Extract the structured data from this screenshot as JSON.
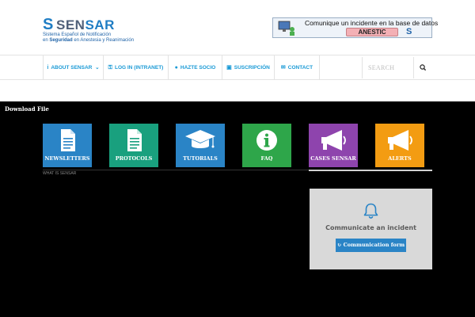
{
  "header": {
    "logo": {
      "mark": "S",
      "name_a": "SEN",
      "name_b": "SAR",
      "sub_line1": "Sistema Español de Notificación",
      "sub_line2_a": "en ",
      "sub_line2_b": "Seguridad",
      "sub_line2_c": " en Anestesia y Reanimación"
    },
    "banner": {
      "line1": "Comunique un incidente en la base de datos",
      "button": "ANESTIC",
      "mark": "S"
    }
  },
  "nav": {
    "items": [
      {
        "label": "ABOUT SENSAR",
        "icon": "info-icon",
        "icon_glyph": "i",
        "has_caret": true
      },
      {
        "label": "LOG IN (INTRANET)",
        "icon": "key-icon",
        "icon_glyph": "⚿"
      },
      {
        "label": "HAZTE SOCIO",
        "icon": "user-icon",
        "icon_glyph": "●"
      },
      {
        "label": "SUSCRIPCIÓN",
        "icon": "square-icon",
        "icon_glyph": "▣"
      },
      {
        "label": "CONTACT",
        "icon": "mail-icon",
        "icon_glyph": "✉"
      }
    ],
    "caret": "⌄",
    "search_placeholder": "SEARCH"
  },
  "main": {
    "download_label": "Download File",
    "tiles": [
      {
        "label": "NEWSLETTERS",
        "icon": "document-icon",
        "color": "#2a84c6"
      },
      {
        "label": "PROTOCOLS",
        "icon": "document-icon",
        "color": "#19a07e"
      },
      {
        "label": "TUTORIALS",
        "icon": "graduation-cap-icon",
        "color": "#2a84c6"
      },
      {
        "label": "FAQ",
        "icon": "info-circle-icon",
        "color": "#2ea64a"
      },
      {
        "label": "CASES SENSAR",
        "icon": "megaphone-icon",
        "color": "#8e44ad"
      },
      {
        "label": "ALERTS",
        "icon": "megaphone-icon",
        "color": "#f39c12"
      }
    ],
    "what_is": "WHAT IS SENSAR",
    "incident": {
      "title": "Communicate an incident",
      "button": "Communication form",
      "button_icon": "↻"
    }
  },
  "colors": {
    "accent": "#1a9ad6",
    "button_blue": "#2a84c6"
  }
}
